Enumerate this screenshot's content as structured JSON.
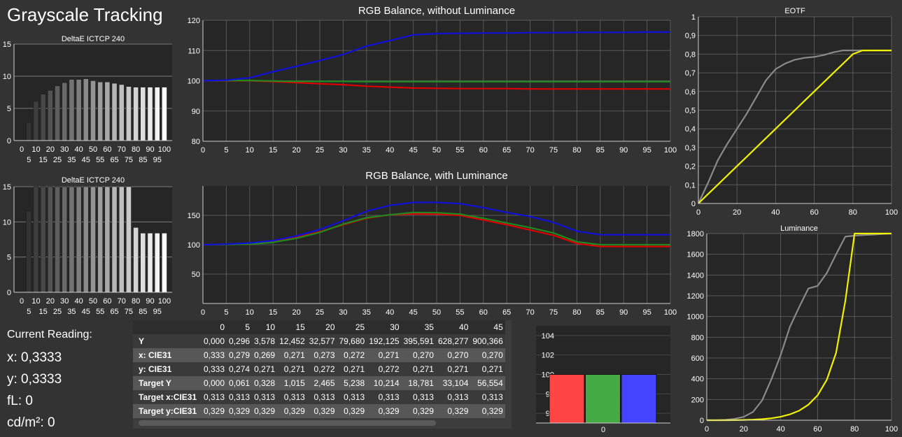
{
  "page": {
    "title": "Grayscale Tracking"
  },
  "reading": {
    "heading": "Current Reading:",
    "x": "x: 0,3333",
    "y": "y: 0,3333",
    "fl": "fL: 0",
    "cdm2": "cd/m²: 0"
  },
  "table": {
    "columns": [
      "",
      "0",
      "5",
      "10",
      "15",
      "20",
      "25",
      "30",
      "35",
      "40",
      "45"
    ],
    "rows": [
      {
        "label": "Y",
        "values": [
          "0,000",
          "0,296",
          "3,578",
          "12,452",
          "32,577",
          "79,680",
          "192,125",
          "395,591",
          "628,277",
          "900,366"
        ]
      },
      {
        "label": "x: CIE31",
        "values": [
          "0,333",
          "0,279",
          "0,269",
          "0,271",
          "0,273",
          "0,272",
          "0,271",
          "0,270",
          "0,270",
          "0,270"
        ]
      },
      {
        "label": "y: CIE31",
        "values": [
          "0,333",
          "0,274",
          "0,271",
          "0,271",
          "0,272",
          "0,271",
          "0,272",
          "0,271",
          "0,271",
          "0,271"
        ]
      },
      {
        "label": "Target Y",
        "values": [
          "0,000",
          "0,061",
          "0,328",
          "1,015",
          "2,465",
          "5,238",
          "10,214",
          "18,781",
          "33,104",
          "56,554"
        ]
      },
      {
        "label": "Target x:CIE31",
        "values": [
          "0,313",
          "0,313",
          "0,313",
          "0,313",
          "0,313",
          "0,313",
          "0,313",
          "0,313",
          "0,313",
          "0,313"
        ]
      },
      {
        "label": "Target y:CIE31",
        "values": [
          "0,329",
          "0,329",
          "0,329",
          "0,329",
          "0,329",
          "0,329",
          "0,329",
          "0,329",
          "0,329",
          "0,329"
        ]
      }
    ]
  },
  "colors": {
    "red": "#dd0000",
    "green": "#1f8a1f",
    "blue": "#1010d8",
    "gray": "#8a8a8a",
    "yellow": "#f0f000"
  },
  "chart_data": [
    {
      "id": "deltae1",
      "type": "bar",
      "title": "DeltaE ICTCP 240",
      "categories": [
        0,
        5,
        10,
        15,
        20,
        25,
        30,
        35,
        40,
        45,
        50,
        55,
        60,
        65,
        70,
        75,
        80,
        85,
        90,
        95,
        100
      ],
      "values": [
        0,
        2.8,
        6.1,
        7.2,
        7.8,
        8.5,
        9.0,
        9.5,
        9.5,
        9.6,
        9.3,
        9.1,
        9.1,
        8.9,
        8.7,
        8.4,
        8.3,
        8.3,
        8.3,
        8.3,
        8.3
      ],
      "ylim": [
        0,
        15
      ],
      "yticks": [
        0,
        5,
        10,
        15
      ],
      "xticks_top": [
        "0",
        "10",
        "20",
        "30",
        "40",
        "50",
        "60",
        "70",
        "80",
        "90",
        "100"
      ],
      "xticks_bottom": [
        "5",
        "15",
        "25",
        "35",
        "45",
        "55",
        "65",
        "75",
        "85",
        "95"
      ]
    },
    {
      "id": "deltae2",
      "type": "bar",
      "title": "DeltaE ICTCP 240",
      "categories": [
        0,
        5,
        10,
        15,
        20,
        25,
        30,
        35,
        40,
        45,
        50,
        55,
        60,
        65,
        70,
        75,
        80,
        85,
        90,
        95,
        100
      ],
      "values": [
        0,
        11.5,
        15,
        15,
        15,
        15,
        15,
        15,
        15,
        15,
        15,
        15,
        15,
        15,
        15,
        15,
        9.2,
        8.4,
        8.4,
        8.4,
        8.4
      ],
      "ylim": [
        0,
        15
      ],
      "yticks": [
        0,
        5,
        10,
        15
      ],
      "xticks_top": [
        "0",
        "10",
        "20",
        "30",
        "40",
        "50",
        "60",
        "70",
        "80",
        "90",
        "100"
      ],
      "xticks_bottom": [
        "5",
        "15",
        "25",
        "35",
        "45",
        "55",
        "65",
        "75",
        "85",
        "95"
      ]
    },
    {
      "id": "rgb1",
      "type": "line",
      "title": "RGB Balance, without Luminance",
      "x": [
        0,
        5,
        10,
        15,
        20,
        25,
        30,
        35,
        40,
        45,
        50,
        55,
        60,
        65,
        70,
        75,
        80,
        85,
        90,
        95,
        100
      ],
      "series": [
        {
          "color": "red",
          "values": [
            100,
            100,
            100,
            99.7,
            99.4,
            99.0,
            98.7,
            98.2,
            97.9,
            97.6,
            97.5,
            97.4,
            97.4,
            97.4,
            97.3,
            97.3,
            97.3,
            97.3,
            97.3,
            97.3,
            97.3
          ]
        },
        {
          "color": "green",
          "values": [
            100,
            100.1,
            100.1,
            99.9,
            99.8,
            99.8,
            99.8,
            99.7,
            99.7,
            99.7,
            99.7,
            99.7,
            99.7,
            99.7,
            99.7,
            99.7,
            99.7,
            99.7,
            99.7,
            99.7,
            99.7
          ]
        },
        {
          "color": "blue",
          "values": [
            100,
            100.2,
            101,
            103,
            104.8,
            106.7,
            108.7,
            111.5,
            113.3,
            115.2,
            115.6,
            115.7,
            115.8,
            115.8,
            115.9,
            115.9,
            116,
            116,
            116,
            116.1,
            116.1
          ]
        }
      ],
      "ylim": [
        80,
        120
      ],
      "yticks": [
        80,
        90,
        100,
        110,
        120
      ],
      "xticks": [
        0,
        5,
        10,
        15,
        20,
        25,
        30,
        35,
        40,
        45,
        50,
        55,
        60,
        65,
        70,
        75,
        80,
        85,
        90,
        95,
        100
      ]
    },
    {
      "id": "rgb2",
      "type": "line",
      "title": "RGB Balance, with Luminance",
      "x": [
        0,
        5,
        10,
        15,
        20,
        25,
        30,
        35,
        40,
        45,
        50,
        55,
        60,
        65,
        70,
        75,
        80,
        85,
        90,
        95,
        100
      ],
      "series": [
        {
          "color": "red",
          "values": [
            100,
            100.5,
            101,
            104.5,
            112,
            122,
            134,
            145,
            151,
            152.5,
            152,
            150,
            142,
            134,
            125,
            116,
            102,
            97,
            97,
            97,
            97
          ]
        },
        {
          "color": "green",
          "values": [
            100,
            100.5,
            101,
            104,
            111,
            121,
            135,
            146,
            151,
            155,
            154.5,
            152,
            145,
            137,
            129,
            120,
            105,
            100,
            100,
            100,
            100
          ]
        },
        {
          "color": "blue",
          "values": [
            100,
            101,
            103,
            107,
            115,
            126,
            141,
            157,
            167,
            172,
            172,
            170,
            163,
            155,
            148,
            138,
            123,
            117,
            117,
            117,
            117
          ]
        }
      ],
      "ylim": [
        0,
        200
      ],
      "yticks": [
        50,
        100,
        150
      ],
      "xticks": [
        0,
        5,
        10,
        15,
        20,
        25,
        30,
        35,
        40,
        45,
        50,
        55,
        60,
        65,
        70,
        75,
        80,
        85,
        90,
        95,
        100
      ]
    },
    {
      "id": "eotf",
      "type": "line",
      "title": "EOTF",
      "x": [
        0,
        5,
        10,
        15,
        20,
        25,
        30,
        35,
        40,
        45,
        50,
        55,
        60,
        65,
        70,
        75,
        80,
        85,
        90,
        95,
        100
      ],
      "series": [
        {
          "color": "gray",
          "values": [
            0,
            0.11,
            0.23,
            0.32,
            0.4,
            0.48,
            0.57,
            0.66,
            0.72,
            0.75,
            0.77,
            0.78,
            0.785,
            0.795,
            0.81,
            0.82,
            0.82,
            0.82,
            0.82,
            0.82,
            0.82
          ]
        },
        {
          "color": "yellow",
          "values": [
            0,
            0.05,
            0.1,
            0.15,
            0.2,
            0.25,
            0.3,
            0.35,
            0.4,
            0.45,
            0.5,
            0.55,
            0.6,
            0.65,
            0.7,
            0.75,
            0.8,
            0.82,
            0.82,
            0.82,
            0.82
          ]
        }
      ],
      "ylim": [
        0,
        1
      ],
      "yticks": [
        "0",
        "0,1",
        "0,2",
        "0,3",
        "0,4",
        "0,5",
        "0,6",
        "0,7",
        "0,8",
        "0,9",
        "1"
      ],
      "xticks": [
        0,
        20,
        40,
        60,
        80,
        100
      ]
    },
    {
      "id": "luminance",
      "type": "line",
      "title": "Luminance",
      "x": [
        0,
        5,
        10,
        15,
        20,
        25,
        30,
        35,
        40,
        45,
        50,
        55,
        60,
        65,
        70,
        75,
        80,
        85,
        90,
        95,
        100
      ],
      "series": [
        {
          "color": "gray",
          "values": [
            0,
            0.3,
            3.6,
            12.5,
            32.6,
            79.7,
            192,
            396,
            628,
            900,
            1090,
            1270,
            1295,
            1420,
            1600,
            1770,
            1780,
            1785,
            1790,
            1795,
            1800
          ]
        },
        {
          "color": "yellow",
          "values": [
            0,
            0.06,
            0.33,
            1.0,
            2.5,
            5.2,
            10.2,
            18.8,
            33.1,
            56.6,
            92,
            150,
            240,
            390,
            650,
            1150,
            1800,
            1800,
            1800,
            1800,
            1800
          ]
        }
      ],
      "ylim": [
        0,
        1800
      ],
      "yticks": [
        0,
        200,
        400,
        600,
        800,
        1000,
        1200,
        1400,
        1600,
        1800
      ],
      "xticks": [
        0,
        20,
        40,
        60,
        80,
        100
      ]
    },
    {
      "id": "rgbbars",
      "type": "bar",
      "categories": [
        "0"
      ],
      "series": [
        {
          "color": "#ff4444",
          "values": [
            100
          ]
        },
        {
          "color": "#44aa44",
          "values": [
            100
          ]
        },
        {
          "color": "#4444ff",
          "values": [
            100
          ]
        }
      ],
      "ylim": [
        95,
        105
      ],
      "yticks": [
        96,
        98,
        100,
        102,
        104
      ]
    }
  ]
}
